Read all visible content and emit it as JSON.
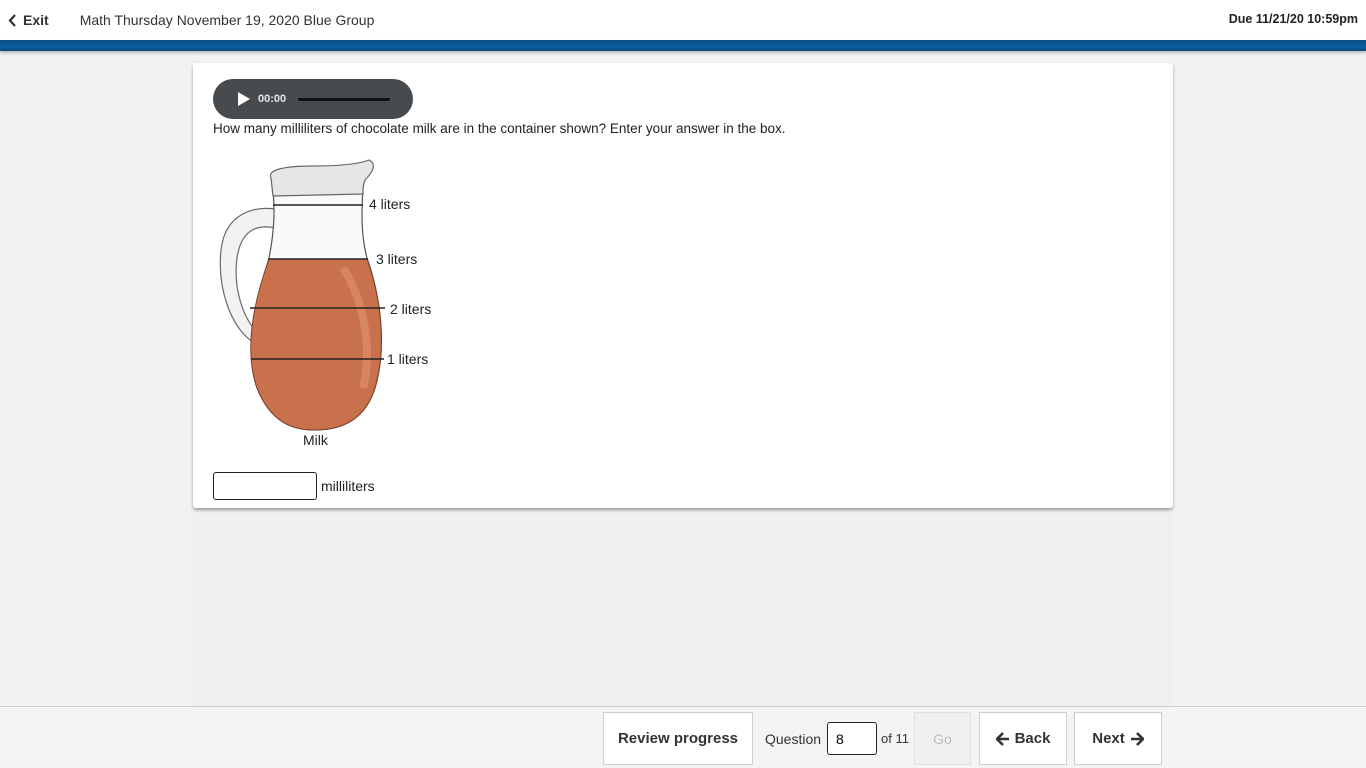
{
  "header": {
    "exit_label": "Exit",
    "title": "Math Thursday November 19, 2020 Blue Group",
    "due": "Due 11/21/20 10:59pm"
  },
  "audio": {
    "time": "00:00"
  },
  "question": {
    "text": "How many milliliters of chocolate milk are in the container shown? Enter your answer in the box.",
    "figure": {
      "label_4": "4 liters",
      "label_3": "3 liters",
      "label_2": "2 liters",
      "label_1": "1 liters",
      "caption": "Milk",
      "milk_color": "#c9714d"
    },
    "answer_value": "",
    "units": "milliliters"
  },
  "footer": {
    "review_label": "Review progress",
    "question_label": "Question",
    "current": "8",
    "total_label": "of 11",
    "go_label": "Go",
    "back_label": "Back",
    "next_label": "Next"
  },
  "colors": {
    "accent": "#0e5d9a",
    "audio_bg": "#484b4e"
  }
}
